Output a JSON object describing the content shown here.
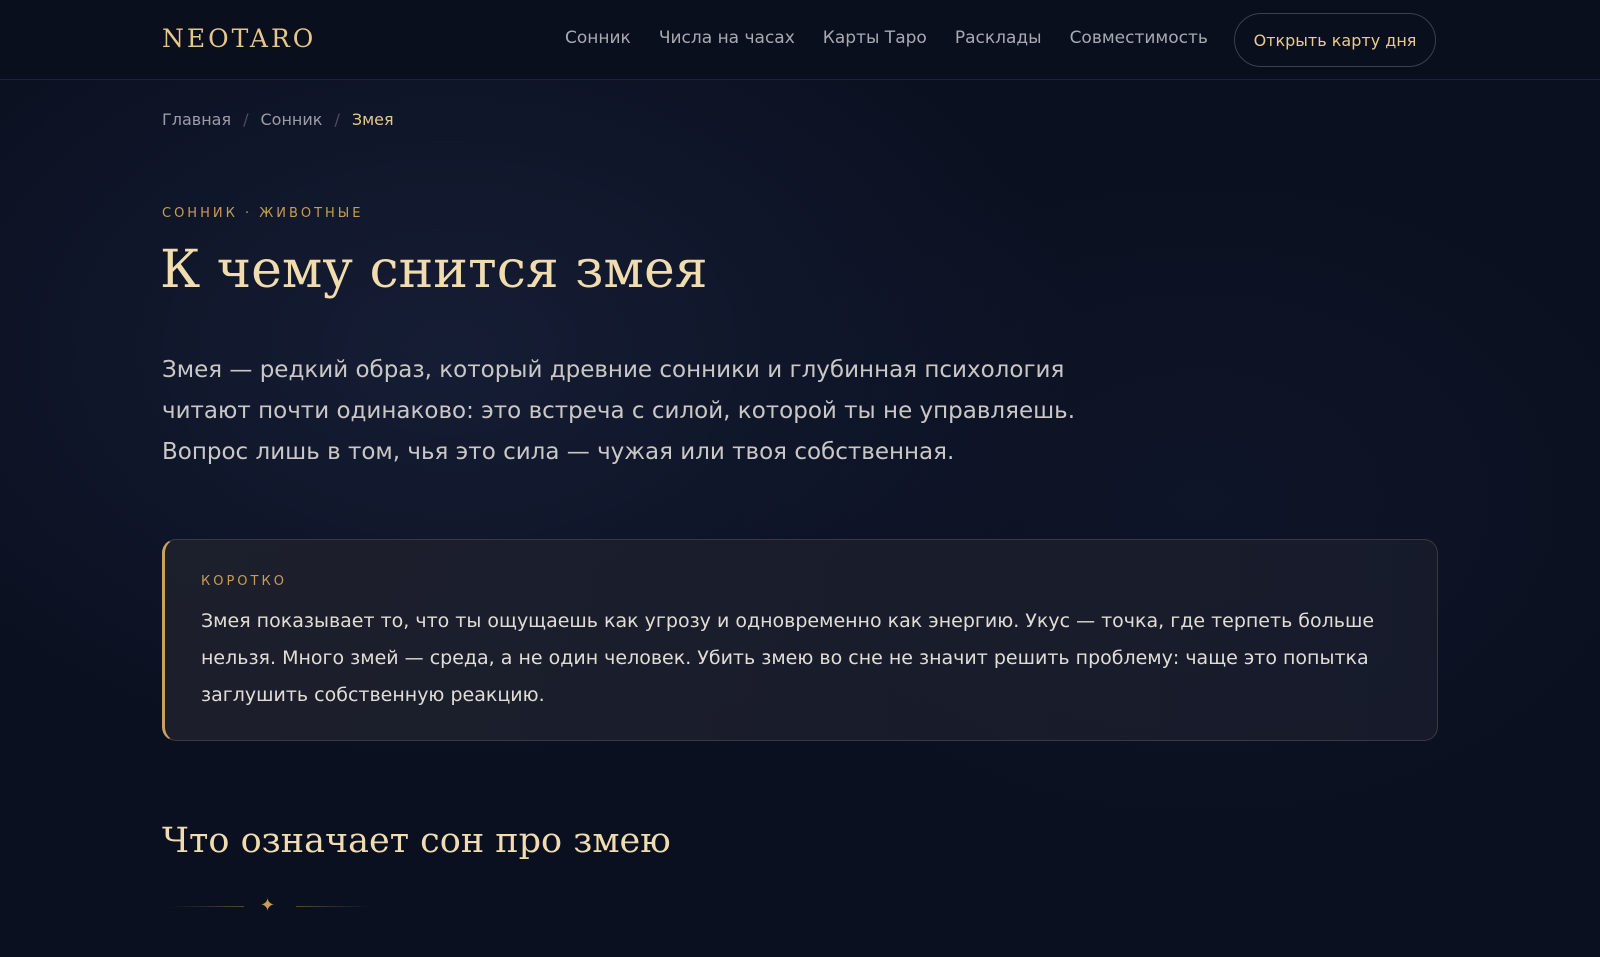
{
  "header": {
    "logo": "NEOTARO",
    "nav": [
      {
        "label": "Сонник"
      },
      {
        "label": "Числа на часах"
      },
      {
        "label": "Карты Таро"
      },
      {
        "label": "Расклады"
      },
      {
        "label": "Совместимость"
      }
    ],
    "cta_label": "Открыть карту дня"
  },
  "breadcrumb": {
    "items": [
      "Главная",
      "Сонник",
      "Змея"
    ],
    "separator": "/"
  },
  "article": {
    "kicker": "СОННИК · ЖИВОТНЫЕ",
    "title": "К чему снится змея",
    "lead": "Змея — редкий образ, который древние сонники и глубинная психология читают почти одинаково: это встреча с силой, которой ты не управляешь. Вопрос лишь в том, чья это сила — чужая или твоя собственная.",
    "callout": {
      "label": "КОРОТКО",
      "text": "Змея показывает то, что ты ощущаешь как угрозу и одновременно как энергию. Укус — точка, где терпеть больше нельзя. Много змей — среда, а не один человек. Убить змею во сне не значит решить проблему: чаще это попытка заглушить собственную реакцию."
    },
    "section_title": "Что означает сон про змею",
    "divider_icon": "sparkle-icon"
  },
  "colors": {
    "background": "#0b1020",
    "accent_gold": "#e6c68a",
    "kicker_gold": "#c99c54",
    "text": "#c9c8c4"
  }
}
